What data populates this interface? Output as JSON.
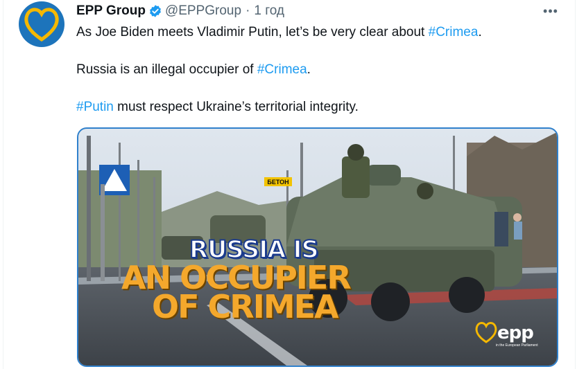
{
  "tweet": {
    "author_name": "EPP Group",
    "handle": "@EPPGroup",
    "separator": "·",
    "time": "1 год",
    "more": "•••",
    "line1_text": "As Joe Biden meets Vladimir Putin, let’s be very clear about ",
    "line1_tag": "#Crimea",
    "line1_end": ".",
    "line2_text": "Russia is an illegal occupier of ",
    "line2_tag": "#Crimea",
    "line2_end": ".",
    "line3_tag": "#Putin",
    "line3_text": " must respect Ukraine’s territorial integrity."
  },
  "media": {
    "caption_line1": "RUSSIA IS",
    "caption_line2": "AN OCCUPIER",
    "caption_line3": "OF CRIMEA",
    "logo_text": "epp",
    "logo_subtext": "in the European Parliament",
    "road_sign_text": "БЕТОН"
  },
  "colors": {
    "link": "#1d9bf0",
    "verified": "#1d9bf0",
    "caption_white": "#ffffff",
    "caption_orange": "#f4a82c",
    "caption_outline": "#1a3a8c"
  }
}
